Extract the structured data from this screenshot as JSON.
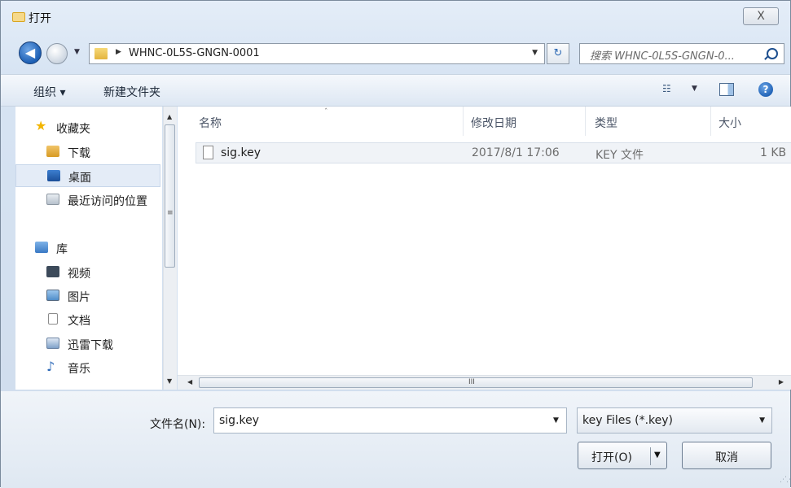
{
  "window": {
    "title": "打开",
    "close_glyph": "X"
  },
  "nav": {
    "address_path": "WHNC-0L5S-GNGN-0001",
    "search_placeholder": "搜索 WHNC-0L5S-GNGN-0..."
  },
  "toolbar": {
    "organize": "组织 ▾",
    "new_folder": "新建文件夹"
  },
  "sidebar": {
    "favorites": "收藏夹",
    "items": [
      "下载",
      "桌面",
      "最近访问的位置"
    ],
    "libraries": "库",
    "library_items": [
      "视频",
      "图片",
      "文档",
      "迅雷下载",
      "音乐"
    ]
  },
  "columns": {
    "name": "名称",
    "modified": "修改日期",
    "type": "类型",
    "size": "大小"
  },
  "files": [
    {
      "name": "sig.key",
      "modified": "2017/8/1 17:06",
      "type": "KEY 文件",
      "size": "1 KB"
    }
  ],
  "bottom": {
    "filename_label": "文件名(N):",
    "filename_value": "sig.key",
    "filetype": "key Files (*.key)",
    "open_label": "打开(O)",
    "cancel_label": "取消"
  },
  "colors": {
    "selection": "#e4ecf7",
    "chrome": "#d7e4f3",
    "accent": "#1d5fb4"
  },
  "icons": [
    "back-icon",
    "forward-icon",
    "folder-icon",
    "refresh-icon",
    "search-icon",
    "view-icon",
    "preview-pane-icon",
    "help-icon",
    "star-icon",
    "download-folder-icon",
    "desktop-icon",
    "recent-places-icon",
    "library-icon",
    "video-icon",
    "pictures-icon",
    "documents-icon",
    "thunder-download-icon",
    "music-icon",
    "file-icon"
  ]
}
